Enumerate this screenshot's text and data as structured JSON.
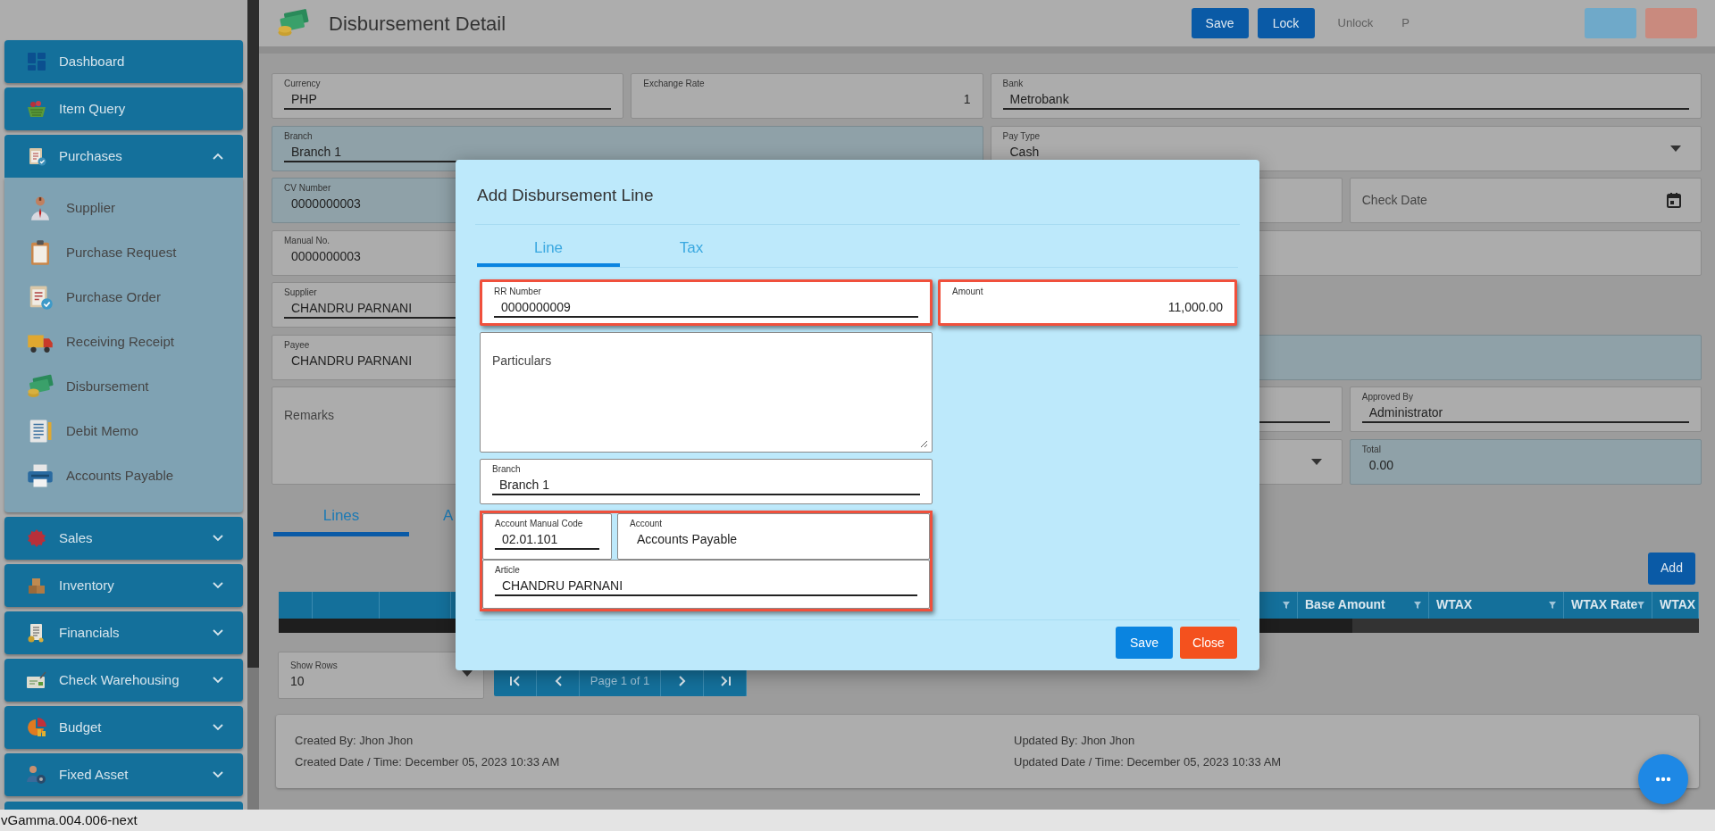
{
  "sidebar": {
    "items": [
      {
        "label": "Dashboard"
      },
      {
        "label": "Item Query"
      },
      {
        "label": "Purchases",
        "expanded": true,
        "children": [
          {
            "label": "Supplier"
          },
          {
            "label": "Purchase Request"
          },
          {
            "label": "Purchase Order"
          },
          {
            "label": "Receiving Receipt"
          },
          {
            "label": "Disbursement"
          },
          {
            "label": "Debit Memo"
          },
          {
            "label": "Accounts Payable"
          }
        ]
      },
      {
        "label": "Sales",
        "expanded": false
      },
      {
        "label": "Inventory",
        "expanded": false
      },
      {
        "label": "Financials",
        "expanded": false
      },
      {
        "label": "Check Warehousing",
        "expanded": false
      },
      {
        "label": "Budget",
        "expanded": false
      },
      {
        "label": "Fixed Asset",
        "expanded": false
      }
    ]
  },
  "header": {
    "title": "Disbursement Detail",
    "buttons": [
      {
        "label": "Save",
        "kind": "primary"
      },
      {
        "label": "Lock",
        "kind": "primary"
      },
      {
        "label": "Unlock",
        "kind": "link"
      },
      {
        "label": "P",
        "kind": "link"
      },
      {
        "kind": "info"
      },
      {
        "kind": "danger"
      }
    ]
  },
  "form": {
    "fields": [
      {
        "kind": "text",
        "label": "Currency",
        "value": "PHP",
        "underline": true,
        "disabled": false
      },
      {
        "kind": "number",
        "label": "Exchange Rate",
        "value": "1",
        "underline": false,
        "disabled": false
      },
      {
        "kind": "text",
        "label": "Bank",
        "value": "Metrobank",
        "underline": true,
        "disabled": false
      },
      {
        "kind": "text",
        "label": "Branch",
        "value": "Branch 1",
        "underline": true,
        "disabled": true
      },
      {
        "kind": "dropdown",
        "label": "Pay Type",
        "value": "Cash",
        "underline": false,
        "disabled": false
      },
      {
        "kind": "text",
        "label": "CV Number",
        "value": "0000000003",
        "underline": false,
        "disabled": true
      },
      {
        "kind": "text",
        "underline": false,
        "disabled": false
      },
      {
        "kind": "date",
        "placeholder": "Check Date",
        "disabled": false
      },
      {
        "kind": "text",
        "label": "Manual No.",
        "value": "0000000003",
        "underline": false,
        "disabled": false
      },
      {
        "kind": "text",
        "underline": false,
        "disabled": false
      },
      {
        "kind": "text",
        "label": "Supplier",
        "value": "CHANDRU PARNANI",
        "underline": true,
        "disabled": false
      },
      {
        "kind": "text",
        "label": "Payee",
        "value": "CHANDRU PARNANI",
        "underline": false,
        "disabled": false
      },
      {
        "kind": "text",
        "underline": false,
        "disabled": true
      },
      {
        "kind": "textarea",
        "placeholder": "Remarks",
        "disabled": false
      },
      {
        "kind": "text",
        "underline": true,
        "disabled": false
      },
      {
        "kind": "text",
        "label": "Approved By",
        "value": "Administrator",
        "underline": true,
        "disabled": false
      },
      {
        "kind": "dropdown",
        "underline": false,
        "disabled": false
      },
      {
        "kind": "text",
        "label": "Total",
        "value": "0.00",
        "underline": false,
        "disabled": true
      }
    ]
  },
  "detail_tabs": [
    {
      "label": "Lines",
      "selected": true
    },
    {
      "label": "A",
      "selected": false
    }
  ],
  "lines_grid": {
    "add_button": "Add",
    "columns": [
      {
        "filter": false
      },
      {
        "filter": false
      },
      {
        "filter": false
      },
      {
        "filter": true
      },
      {
        "label": "Base Amount",
        "filter": true
      },
      {
        "label": "WTAX",
        "filter": true
      },
      {
        "label": "WTAX Rate",
        "filter": true
      },
      {
        "label": "WTAX",
        "filter": false
      }
    ],
    "show_rows": {
      "label": "Show Rows",
      "value": "10"
    },
    "page_indicator": "Page 1 of 1"
  },
  "audit": {
    "created_by": "Created By: Jhon Jhon",
    "created_date": "Created Date / Time: December 05, 2023 10:33 AM",
    "updated_by": "Updated By: Jhon Jhon",
    "updated_date": "Updated Date / Time: December 05, 2023 10:33 AM"
  },
  "modal": {
    "title": "Add Disbursement Line",
    "tabs": [
      {
        "label": "Line",
        "selected": true
      },
      {
        "label": "Tax",
        "selected": false
      }
    ],
    "fields": [
      {
        "kind": "text",
        "label": "RR Number",
        "value": "0000000009",
        "underline": true,
        "highlighted": true
      },
      {
        "kind": "number",
        "label": "Amount",
        "value": "11,000.00",
        "underline": false,
        "highlighted": true
      },
      {
        "kind": "textarea",
        "placeholder": "Particulars",
        "highlighted": false
      },
      {
        "kind": "text",
        "label": "Branch",
        "value": "Branch 1",
        "underline": true,
        "highlighted": false
      },
      {
        "kind": "group",
        "highlighted": true,
        "fields": [
          {
            "kind": "text",
            "label": "Account Manual Code",
            "value": "02.01.101",
            "underline": true
          },
          {
            "kind": "text",
            "label": "Account",
            "value": "Accounts Payable",
            "underline": false
          },
          {
            "kind": "text",
            "label": "Article",
            "value": "CHANDRU PARNANI",
            "underline": true
          }
        ]
      }
    ],
    "buttons": [
      {
        "label": "Save",
        "kind": "primary"
      },
      {
        "label": "Close",
        "kind": "danger"
      }
    ]
  },
  "status_bar": "vGamma.004.006-next"
}
